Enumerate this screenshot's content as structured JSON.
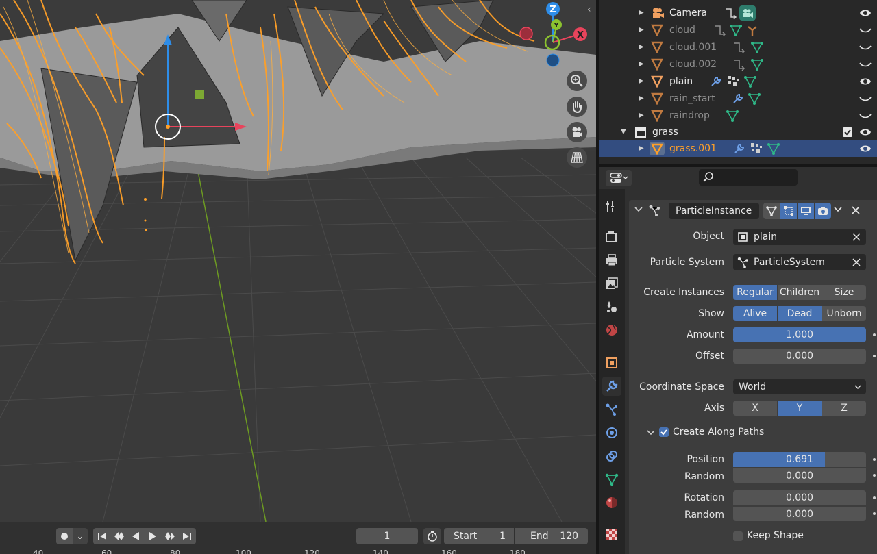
{
  "outliner": {
    "items": [
      {
        "label": "Camera",
        "muted": false
      },
      {
        "label": "cloud",
        "muted": true
      },
      {
        "label": "cloud.001",
        "muted": true
      },
      {
        "label": "cloud.002",
        "muted": true
      },
      {
        "label": "plain",
        "muted": false
      },
      {
        "label": "rain_start",
        "muted": true
      },
      {
        "label": "raindrop",
        "muted": true
      }
    ],
    "collection_label": "grass",
    "selected_label": "grass.001"
  },
  "properties": {
    "search_placeholder": "",
    "modifier_name": "ParticleInstance",
    "object_label": "Object",
    "object_value": "plain",
    "particle_system_label": "Particle System",
    "particle_system_value": "ParticleSystem",
    "create_instances_label": "Create Instances",
    "create_instances_options": [
      "Regular",
      "Children",
      "Size"
    ],
    "create_instances_active": [
      "Regular"
    ],
    "show_label": "Show",
    "show_options": [
      "Alive",
      "Dead",
      "Unborn"
    ],
    "show_active": [
      "Alive",
      "Dead"
    ],
    "amount_label": "Amount",
    "amount_value": "1.000",
    "amount_fraction": 1.0,
    "offset_label": "Offset",
    "offset_value": "0.000",
    "coordinate_space_label": "Coordinate Space",
    "coordinate_space_value": "World",
    "axis_label": "Axis",
    "axis_options": [
      "X",
      "Y",
      "Z"
    ],
    "axis_active": "Y",
    "create_along_paths_label": "Create Along Paths",
    "create_along_paths_checked": true,
    "position_label": "Position",
    "position_value": "0.691",
    "position_fraction": 0.691,
    "position_random_label": "Random",
    "position_random_value": "0.000",
    "rotation_label": "Rotation",
    "rotation_value": "0.000",
    "rotation_random_label": "Random",
    "rotation_random_value": "0.000",
    "keep_shape_label": "Keep Shape",
    "keep_shape_checked": false
  },
  "timeline": {
    "current_frame": "1",
    "start_label": "Start",
    "start_value": "1",
    "end_label": "End",
    "end_value": "120",
    "ruler": [
      "40",
      "60",
      "80",
      "100",
      "120",
      "140",
      "160",
      "180"
    ]
  },
  "gizmo": {
    "z": "Z",
    "x": "X",
    "y": "Y"
  },
  "colors": {
    "accent": "#4772b3",
    "selected_row": "#334d80",
    "selection_orange": "#ffa028",
    "axis_x": "#e8445c",
    "axis_y": "#8bc22f",
    "axis_z": "#2e8de8"
  }
}
